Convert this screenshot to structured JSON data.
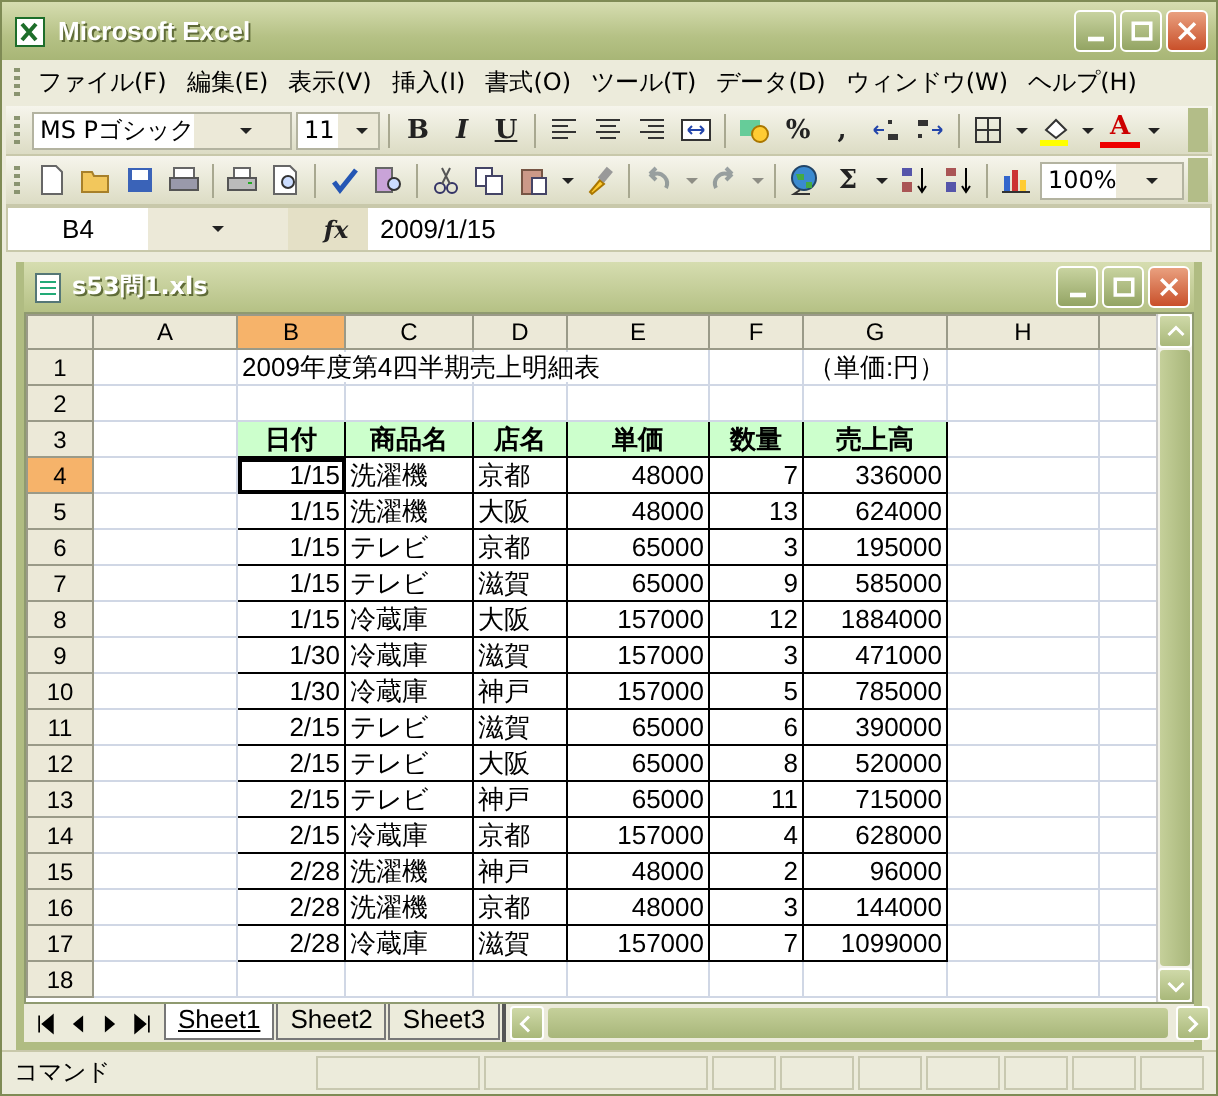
{
  "window": {
    "title": "Microsoft Excel"
  },
  "menu": [
    "ファイル(F)",
    "編集(E)",
    "表示(V)",
    "挿入(I)",
    "書式(O)",
    "ツール(T)",
    "データ(D)",
    "ウィンドウ(W)",
    "ヘルプ(H)"
  ],
  "format_toolbar": {
    "font": "MS Pゴシック",
    "size": "11",
    "bold": "B",
    "italic": "I",
    "underline": "U",
    "percent": "%",
    "comma": ",",
    "font_color": "A"
  },
  "standard_toolbar": {
    "undo": {
      "disabled": true
    },
    "redo": {
      "disabled": true
    },
    "autosum": "Σ",
    "zoom": "100%"
  },
  "formula_bar": {
    "name_box": "B4",
    "function_label": "fx",
    "value": "2009/1/15"
  },
  "workbook": {
    "title": "s53問1.xls",
    "columns": [
      {
        "label": "A",
        "selected": false
      },
      {
        "label": "B",
        "selected": true
      },
      {
        "label": "C",
        "selected": false
      },
      {
        "label": "D",
        "selected": false
      },
      {
        "label": "E",
        "selected": false
      },
      {
        "label": "F",
        "selected": false
      },
      {
        "label": "G",
        "selected": false
      },
      {
        "label": "H",
        "selected": false
      }
    ],
    "rows": [
      {
        "label": "1",
        "selected": false,
        "kind": "title",
        "cells": {
          "b": "2009年度第4四半期売上明細表",
          "g": "（単価:円）"
        }
      },
      {
        "label": "2",
        "selected": false,
        "kind": "blank",
        "cells": {}
      },
      {
        "label": "3",
        "selected": false,
        "kind": "header",
        "cells": {
          "b": "日付",
          "c": "商品名",
          "d": "店名",
          "e": "単価",
          "f": "数量",
          "g": "売上高"
        }
      },
      {
        "label": "4",
        "selected": true,
        "kind": "data",
        "cells": {
          "b": "1/15",
          "c": "洗濯機",
          "d": "京都",
          "e": "48000",
          "f": "7",
          "g": "336000"
        }
      },
      {
        "label": "5",
        "selected": false,
        "kind": "data",
        "cells": {
          "b": "1/15",
          "c": "洗濯機",
          "d": "大阪",
          "e": "48000",
          "f": "13",
          "g": "624000"
        }
      },
      {
        "label": "6",
        "selected": false,
        "kind": "data",
        "cells": {
          "b": "1/15",
          "c": "テレビ",
          "d": "京都",
          "e": "65000",
          "f": "3",
          "g": "195000"
        }
      },
      {
        "label": "7",
        "selected": false,
        "kind": "data",
        "cells": {
          "b": "1/15",
          "c": "テレビ",
          "d": "滋賀",
          "e": "65000",
          "f": "9",
          "g": "585000"
        }
      },
      {
        "label": "8",
        "selected": false,
        "kind": "data",
        "cells": {
          "b": "1/15",
          "c": "冷蔵庫",
          "d": "大阪",
          "e": "157000",
          "f": "12",
          "g": "1884000"
        }
      },
      {
        "label": "9",
        "selected": false,
        "kind": "data",
        "cells": {
          "b": "1/30",
          "c": "冷蔵庫",
          "d": "滋賀",
          "e": "157000",
          "f": "3",
          "g": "471000"
        }
      },
      {
        "label": "10",
        "selected": false,
        "kind": "data",
        "cells": {
          "b": "1/30",
          "c": "冷蔵庫",
          "d": "神戸",
          "e": "157000",
          "f": "5",
          "g": "785000"
        }
      },
      {
        "label": "11",
        "selected": false,
        "kind": "data",
        "cells": {
          "b": "2/15",
          "c": "テレビ",
          "d": "滋賀",
          "e": "65000",
          "f": "6",
          "g": "390000"
        }
      },
      {
        "label": "12",
        "selected": false,
        "kind": "data",
        "cells": {
          "b": "2/15",
          "c": "テレビ",
          "d": "大阪",
          "e": "65000",
          "f": "8",
          "g": "520000"
        }
      },
      {
        "label": "13",
        "selected": false,
        "kind": "data",
        "cells": {
          "b": "2/15",
          "c": "テレビ",
          "d": "神戸",
          "e": "65000",
          "f": "11",
          "g": "715000"
        }
      },
      {
        "label": "14",
        "selected": false,
        "kind": "data",
        "cells": {
          "b": "2/15",
          "c": "冷蔵庫",
          "d": "京都",
          "e": "157000",
          "f": "4",
          "g": "628000"
        }
      },
      {
        "label": "15",
        "selected": false,
        "kind": "data",
        "cells": {
          "b": "2/28",
          "c": "洗濯機",
          "d": "神戸",
          "e": "48000",
          "f": "2",
          "g": "96000"
        }
      },
      {
        "label": "16",
        "selected": false,
        "kind": "data",
        "cells": {
          "b": "2/28",
          "c": "洗濯機",
          "d": "京都",
          "e": "48000",
          "f": "3",
          "g": "144000"
        }
      },
      {
        "label": "17",
        "selected": false,
        "kind": "data",
        "cells": {
          "b": "2/28",
          "c": "冷蔵庫",
          "d": "滋賀",
          "e": "157000",
          "f": "7",
          "g": "1099000"
        }
      },
      {
        "label": "18",
        "selected": false,
        "kind": "blank",
        "cells": {}
      }
    ],
    "sheet_tabs": [
      {
        "label": "Sheet1",
        "selected": true
      },
      {
        "label": "Sheet2",
        "selected": false
      },
      {
        "label": "Sheet3",
        "selected": false
      }
    ]
  },
  "status_bar": {
    "text": "コマンド"
  }
}
